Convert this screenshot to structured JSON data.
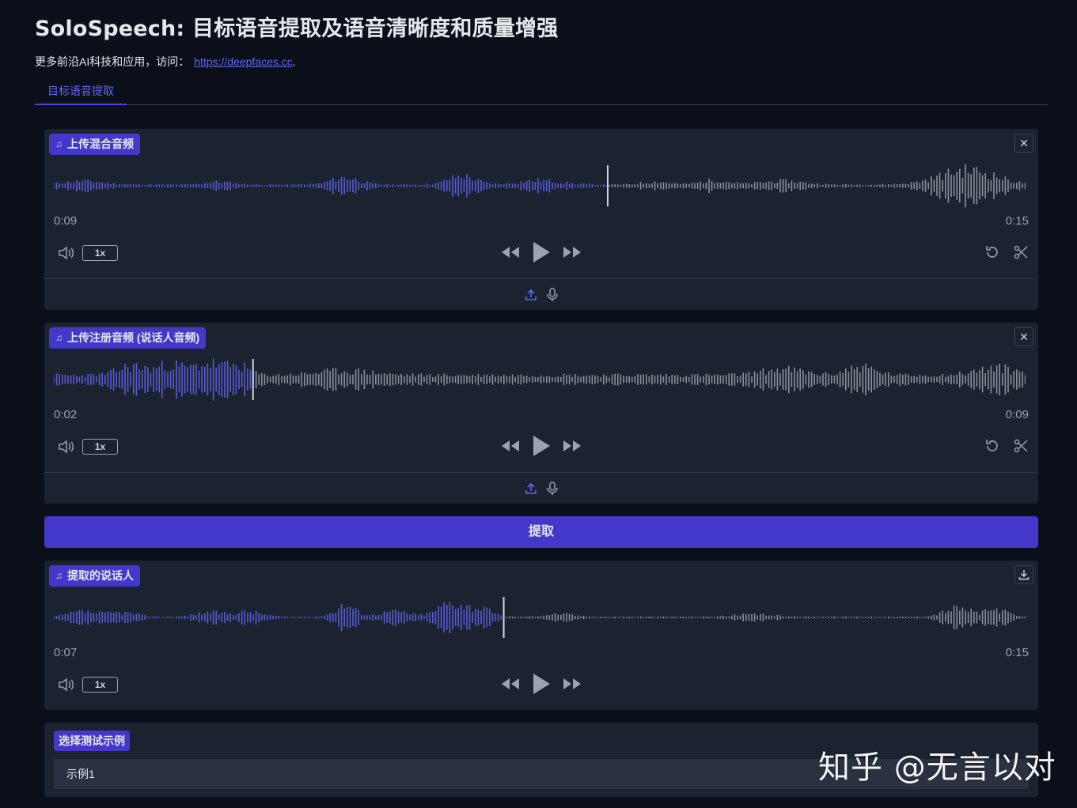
{
  "page": {
    "title": "SoloSpeech: 目标语音提取及语音清晰度和质量增强",
    "subtitle_prefix": "更多前沿AI科技和应用，访问：",
    "subtitle_link": "https://deepfaces.cc",
    "subtitle_suffix": "."
  },
  "tabs": [
    {
      "label": "目标语音提取",
      "active": true
    }
  ],
  "colors": {
    "accent": "#4338ca",
    "played_wave": "#5b5bd6",
    "unplayed_wave": "#8b8f99",
    "background": "#0b0f19"
  },
  "mixed_audio": {
    "label": "上传混合音频",
    "current_time": "0:09",
    "duration": "0:15",
    "played_fraction": 0.57,
    "rate": "1x",
    "close_icon": "close-icon",
    "footer_icons": [
      "upload-icon",
      "microphone-icon"
    ]
  },
  "enroll_audio": {
    "label": "上传注册音频 (说话人音频)",
    "current_time": "0:02",
    "duration": "0:09",
    "played_fraction": 0.205,
    "rate": "1x",
    "close_icon": "close-icon",
    "footer_icons": [
      "upload-icon",
      "microphone-icon"
    ]
  },
  "extract_button": {
    "label": "提取"
  },
  "output_audio": {
    "label": "提取的说话人",
    "current_time": "0:07",
    "duration": "0:15",
    "played_fraction": 0.463,
    "rate": "1x",
    "download_icon": "download-icon"
  },
  "examples": {
    "label": "选择测试示例",
    "selected": "示例1"
  },
  "watermark": "知乎 @无言以对"
}
